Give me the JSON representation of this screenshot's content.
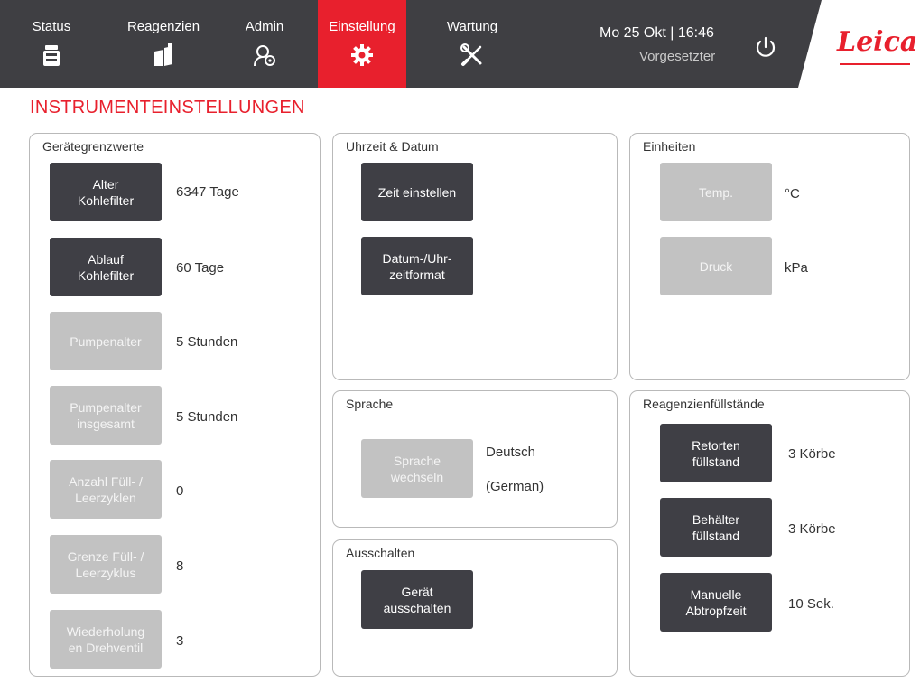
{
  "nav": {
    "tabs": [
      {
        "label": "Status",
        "icon": "status-icon"
      },
      {
        "label": "Reagenzien",
        "icon": "reagents-icon"
      },
      {
        "label": "Admin",
        "icon": "admin-icon"
      },
      {
        "label": "Einstellung",
        "icon": "settings-gear-icon",
        "active": true
      },
      {
        "label": "Wartung",
        "icon": "wrench-screwdriver-icon"
      }
    ],
    "datetime": "Mo 25 Okt | 16:46",
    "user": "Vorgesetzter",
    "logo": "Leica"
  },
  "page_title": "INSTRUMENTEINSTELLUNGEN",
  "geraetegrenzwerte": {
    "title": "Gerätegrenzwerte",
    "rows": [
      {
        "label": "Alter\nKohlefilter",
        "value": "6347 Tage",
        "enabled": true
      },
      {
        "label": "Ablauf\nKohlefilter",
        "value": "60 Tage",
        "enabled": true
      },
      {
        "label": "Pumpenalter",
        "value": "5 Stunden",
        "enabled": false
      },
      {
        "label": "Pumpenalter\ninsgesamt",
        "value": "5 Stunden",
        "enabled": false
      },
      {
        "label": "Anzahl Füll- /\nLeerzyklen",
        "value": "0",
        "enabled": false
      },
      {
        "label": "Grenze Füll- /\nLeerzyklus",
        "value": "8",
        "enabled": false
      },
      {
        "label": "Wiederholung\nen Drehventil",
        "value": "3",
        "enabled": false
      }
    ]
  },
  "uhrzeit": {
    "title": "Uhrzeit & Datum",
    "set_time": "Zeit einstellen",
    "format": "Datum-/Uhr-\nzeitformat"
  },
  "sprache": {
    "title": "Sprache",
    "button": "Sprache\nwechseln",
    "value": "Deutsch\n\n(German)"
  },
  "ausschalten": {
    "title": "Ausschalten",
    "button": "Gerät\nausschalten"
  },
  "einheiten": {
    "title": "Einheiten",
    "temp_label": "Temp.",
    "temp_value": "°C",
    "pressure_label": "Druck",
    "pressure_value": "kPa"
  },
  "reagenzien": {
    "title": "Reagenzienfüllstände",
    "rows": [
      {
        "label": "Retorten\nfüllstand",
        "value": "3 Körbe"
      },
      {
        "label": "Behälter\nfüllstand",
        "value": "3 Körbe"
      },
      {
        "label": "Manuelle\nAbtropfzeit",
        "value": "10 Sek."
      }
    ]
  },
  "colors": {
    "accent": "#e8202d",
    "bar": "#3f3f43",
    "button": "#3f3f45",
    "disabled": "#c2c2c2"
  }
}
